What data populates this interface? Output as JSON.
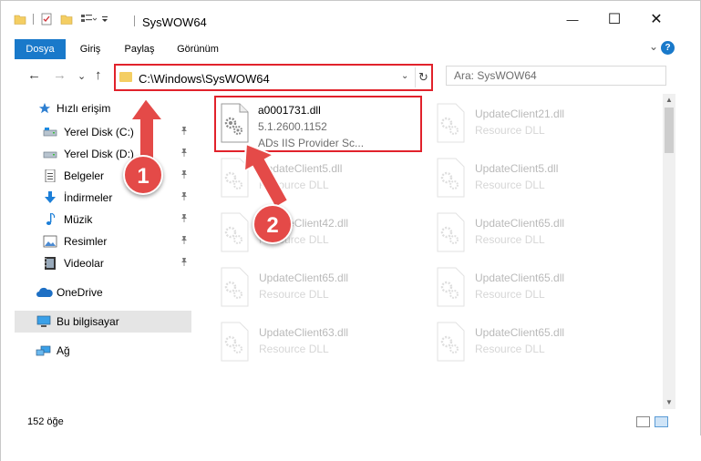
{
  "titlebar": {
    "title": "SysWOW64",
    "minimize_glyph": "—",
    "maximize_glyph": "☐",
    "close_glyph": "✕"
  },
  "ribbon": {
    "tabs": [
      {
        "label": "Dosya",
        "active": true
      },
      {
        "label": "Giriş",
        "active": false
      },
      {
        "label": "Paylaş",
        "active": false
      },
      {
        "label": "Görünüm",
        "active": false
      }
    ],
    "help_label": "?",
    "expand_glyph": "⌄"
  },
  "nav": {
    "back_glyph": "←",
    "forward_glyph": "→",
    "recent_glyph": "⌄",
    "up_glyph": "↑",
    "address": "C:\\Windows\\SysWOW64",
    "dropdown_glyph": "⌄",
    "refresh_glyph": "↻",
    "search_placeholder": "Ara: SysWOW64"
  },
  "sidebar": {
    "quick_access": "Hızlı erişim",
    "items": [
      {
        "label": "Yerel Disk (C:)",
        "icon": "drive-icon"
      },
      {
        "label": "Yerel Disk (D:)",
        "icon": "drive-icon"
      },
      {
        "label": "Belgeler",
        "icon": "documents-icon"
      },
      {
        "label": "İndirmeler",
        "icon": "download-icon"
      },
      {
        "label": "Müzik",
        "icon": "music-icon"
      },
      {
        "label": "Resimler",
        "icon": "pictures-icon"
      },
      {
        "label": "Videolar",
        "icon": "videos-icon"
      }
    ],
    "pin_glyph": "📌",
    "onedrive": "OneDrive",
    "this_pc": "Bu bilgisayar",
    "network": "Ağ"
  },
  "files": [
    {
      "name": "a0001731.dll",
      "line1": "5.1.2600.1152",
      "line2": "ADs IIS Provider Sc..."
    },
    {
      "name": "UpdateClient21.dll",
      "line1": "Resource DLL"
    },
    {
      "name": "UpdateClient5.dll",
      "line1": "Resource DLL"
    },
    {
      "name": "UpdateClient5.dll",
      "line1": "Resource DLL"
    },
    {
      "name": "UpdateClient42.dll",
      "line1": "Resource DLL"
    },
    {
      "name": "UpdateClient65.dll",
      "line1": "Resource DLL"
    },
    {
      "name": "UpdateClient65.dll",
      "line1": "Resource DLL"
    },
    {
      "name": "UpdateClient65.dll",
      "line1": "Resource DLL"
    },
    {
      "name": "UpdateClient63.dll",
      "line1": "Resource DLL"
    },
    {
      "name": "UpdateClient65.dll",
      "line1": "Resource DLL"
    }
  ],
  "status": {
    "count": "152 öğe"
  },
  "annotations": {
    "badge1": "1",
    "badge2": "2",
    "color": "#e44a48"
  }
}
